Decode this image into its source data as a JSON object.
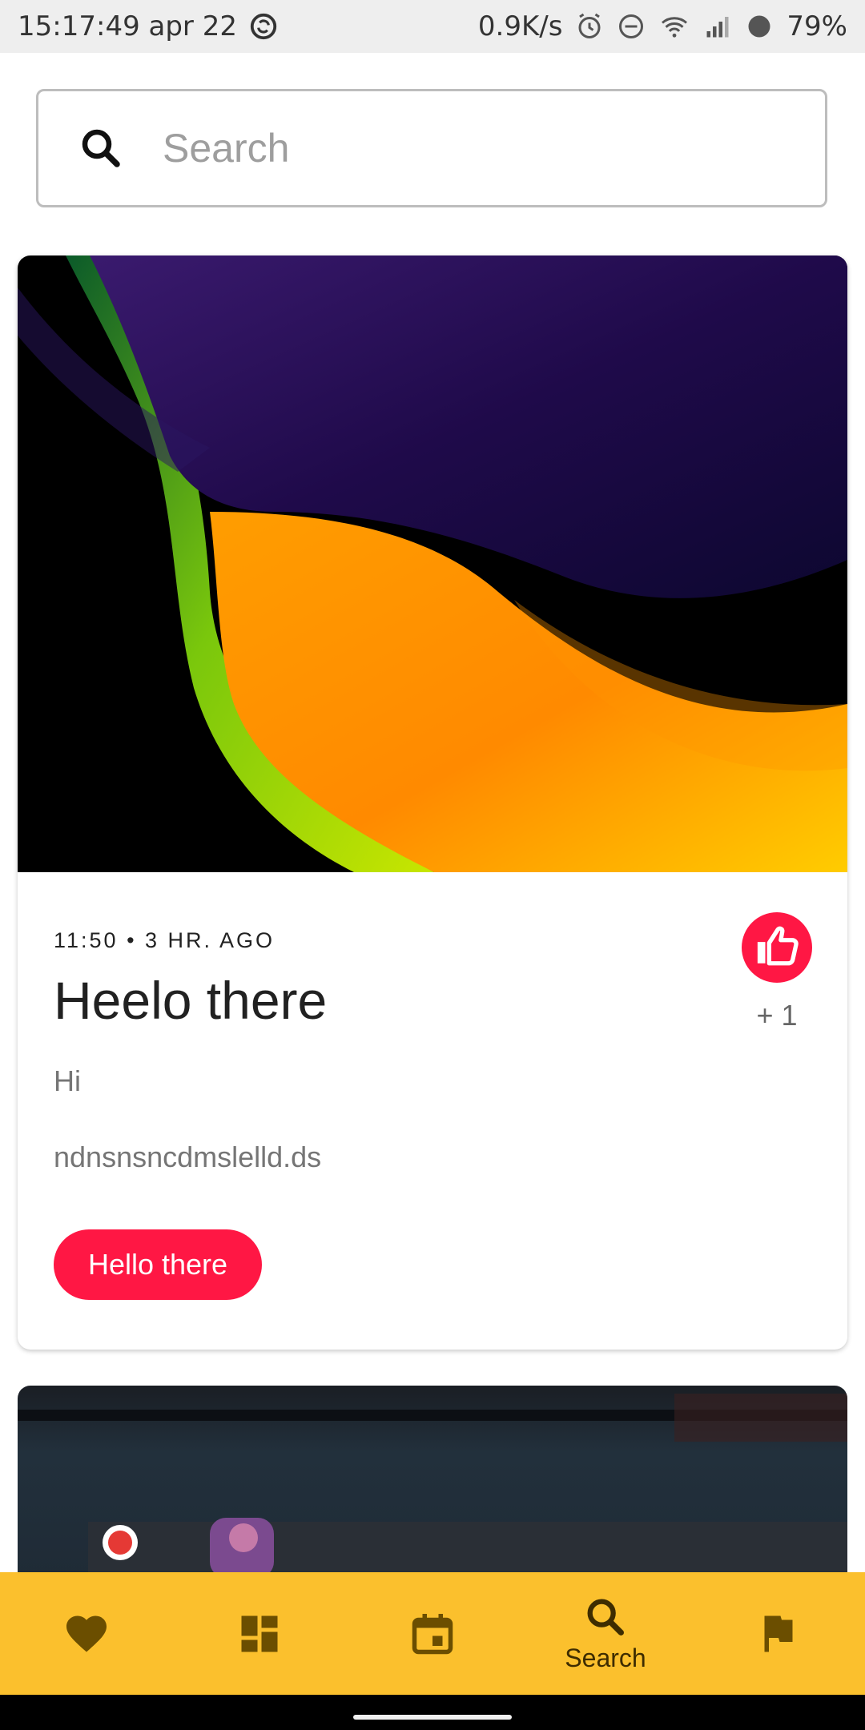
{
  "status_bar": {
    "time_date": "15:17:49 apr 22",
    "net_speed": "0.9K/s",
    "battery": "79%",
    "icons": [
      "sync-icon",
      "alarm-icon",
      "dnd-icon",
      "wifi-icon",
      "signal-icon",
      "battery-icon"
    ]
  },
  "search": {
    "placeholder": "Search",
    "icon": "search-icon"
  },
  "card": {
    "meta": "11:50 • 3 HR. AGO",
    "title": "Heelo there",
    "subtitle": "Hi",
    "description": "ndnsnsncdmslelld.ds",
    "button_label": "Hello there",
    "like_count": "+ 1",
    "like_icon": "thumb-up-icon",
    "accent_color": "#ff1744"
  },
  "bottom_nav": {
    "background": "#fbc02d",
    "items": [
      {
        "icon": "heart-icon",
        "label": ""
      },
      {
        "icon": "dashboard-icon",
        "label": ""
      },
      {
        "icon": "calendar-icon",
        "label": ""
      },
      {
        "icon": "search-icon",
        "label": "Search"
      },
      {
        "icon": "flag-icon",
        "label": ""
      }
    ],
    "active_index": 3
  }
}
